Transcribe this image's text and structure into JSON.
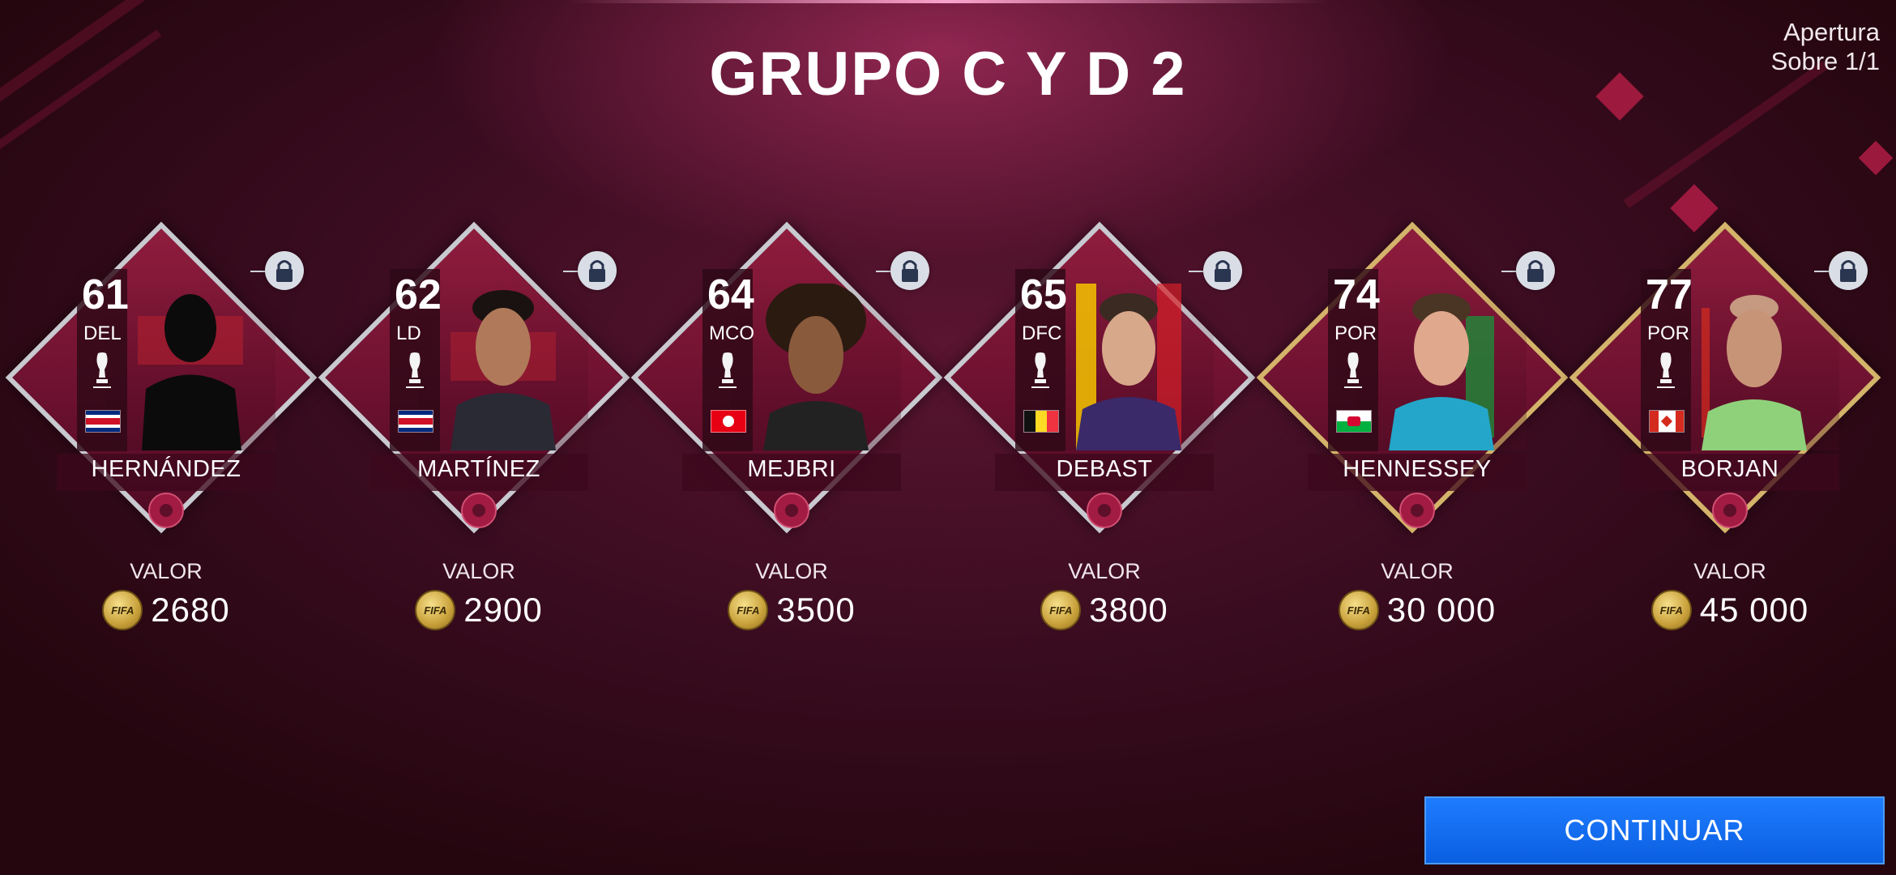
{
  "title": "GRUPO C Y D 2",
  "opening": {
    "line1": "Apertura",
    "line2": "Sobre 1/1"
  },
  "value_label": "VALOR",
  "coin_text": "FIFA",
  "continue_label": "CONTINUAR",
  "colors": {
    "accent_blue": "#0a5fe0",
    "card_silver": "#c9c9d0",
    "card_gold": "#d4b46a",
    "card_maroon": "#8f1c3d"
  },
  "players": [
    {
      "rating": "61",
      "position": "DEL",
      "name": "HERNÁNDEZ",
      "value": "2680",
      "flag": "flag-costa-rica",
      "tier": "silver"
    },
    {
      "rating": "62",
      "position": "LD",
      "name": "MARTÍNEZ",
      "value": "2900",
      "flag": "flag-costa-rica",
      "tier": "silver"
    },
    {
      "rating": "64",
      "position": "MCO",
      "name": "MEJBRI",
      "value": "3500",
      "flag": "flag-tunisia",
      "tier": "silver"
    },
    {
      "rating": "65",
      "position": "DFC",
      "name": "DEBAST",
      "value": "3800",
      "flag": "flag-belgium",
      "tier": "silver"
    },
    {
      "rating": "74",
      "position": "POR",
      "name": "HENNESSEY",
      "value": "30 000",
      "flag": "flag-wales",
      "tier": "gold"
    },
    {
      "rating": "77",
      "position": "POR",
      "name": "BORJAN",
      "value": "45 000",
      "flag": "flag-canada",
      "tier": "gold"
    }
  ]
}
